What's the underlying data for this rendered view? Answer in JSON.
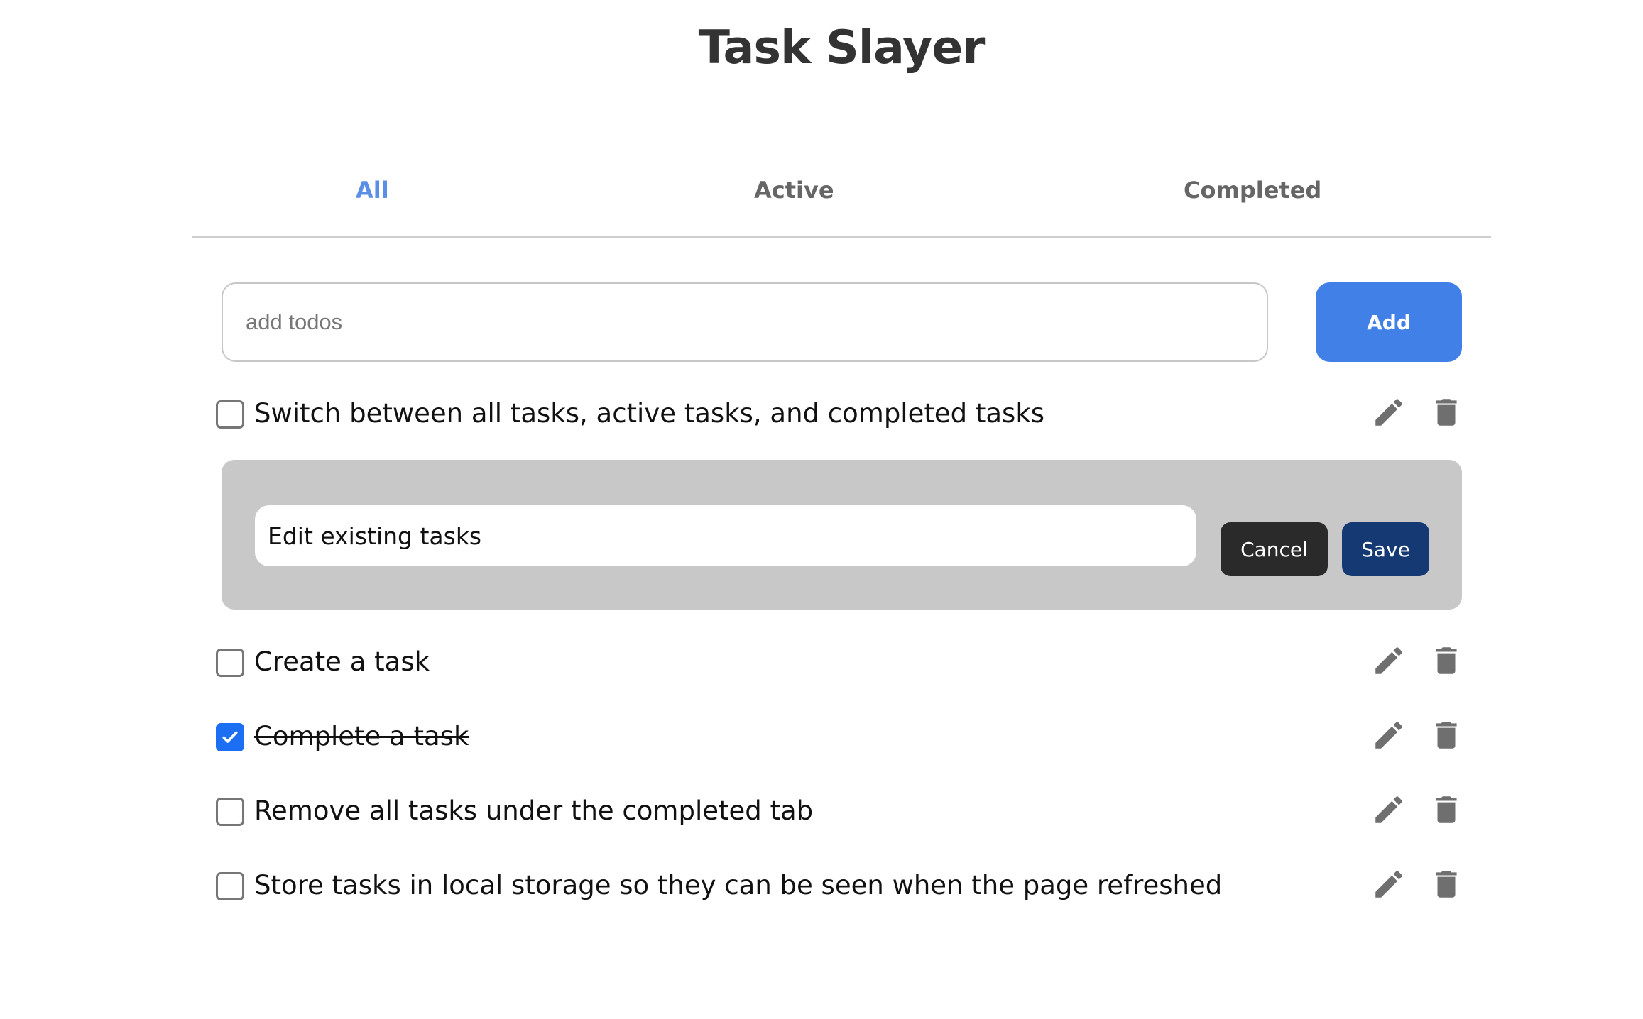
{
  "app": {
    "title": "Task Slayer"
  },
  "tabs": [
    {
      "label": "All",
      "active": true
    },
    {
      "label": "Active",
      "active": false
    },
    {
      "label": "Completed",
      "active": false
    }
  ],
  "add_form": {
    "placeholder": "add todos",
    "value": "",
    "button_label": "Add"
  },
  "edit_form": {
    "value": "Edit existing tasks",
    "cancel_label": "Cancel",
    "save_label": "Save"
  },
  "todos": [
    {
      "text": "Switch between all tasks, active tasks, and completed tasks",
      "completed": false
    },
    {
      "text": "Create a task",
      "completed": false
    },
    {
      "text": "Complete a task",
      "completed": true
    },
    {
      "text": "Remove all tasks under the completed tab",
      "completed": false
    },
    {
      "text": "Store tasks in local storage so they can be seen when the page refreshed",
      "completed": false
    }
  ],
  "icons": {
    "edit": "pencil-icon",
    "delete": "trash-icon",
    "check": "checkmark-icon"
  },
  "colors": {
    "accent": "#4180e6",
    "tab_active": "#5b8fe6",
    "save": "#153a73",
    "cancel": "#2a2a2a",
    "edit_panel": "#c8c8c8",
    "icon": "#6f6f6f"
  }
}
